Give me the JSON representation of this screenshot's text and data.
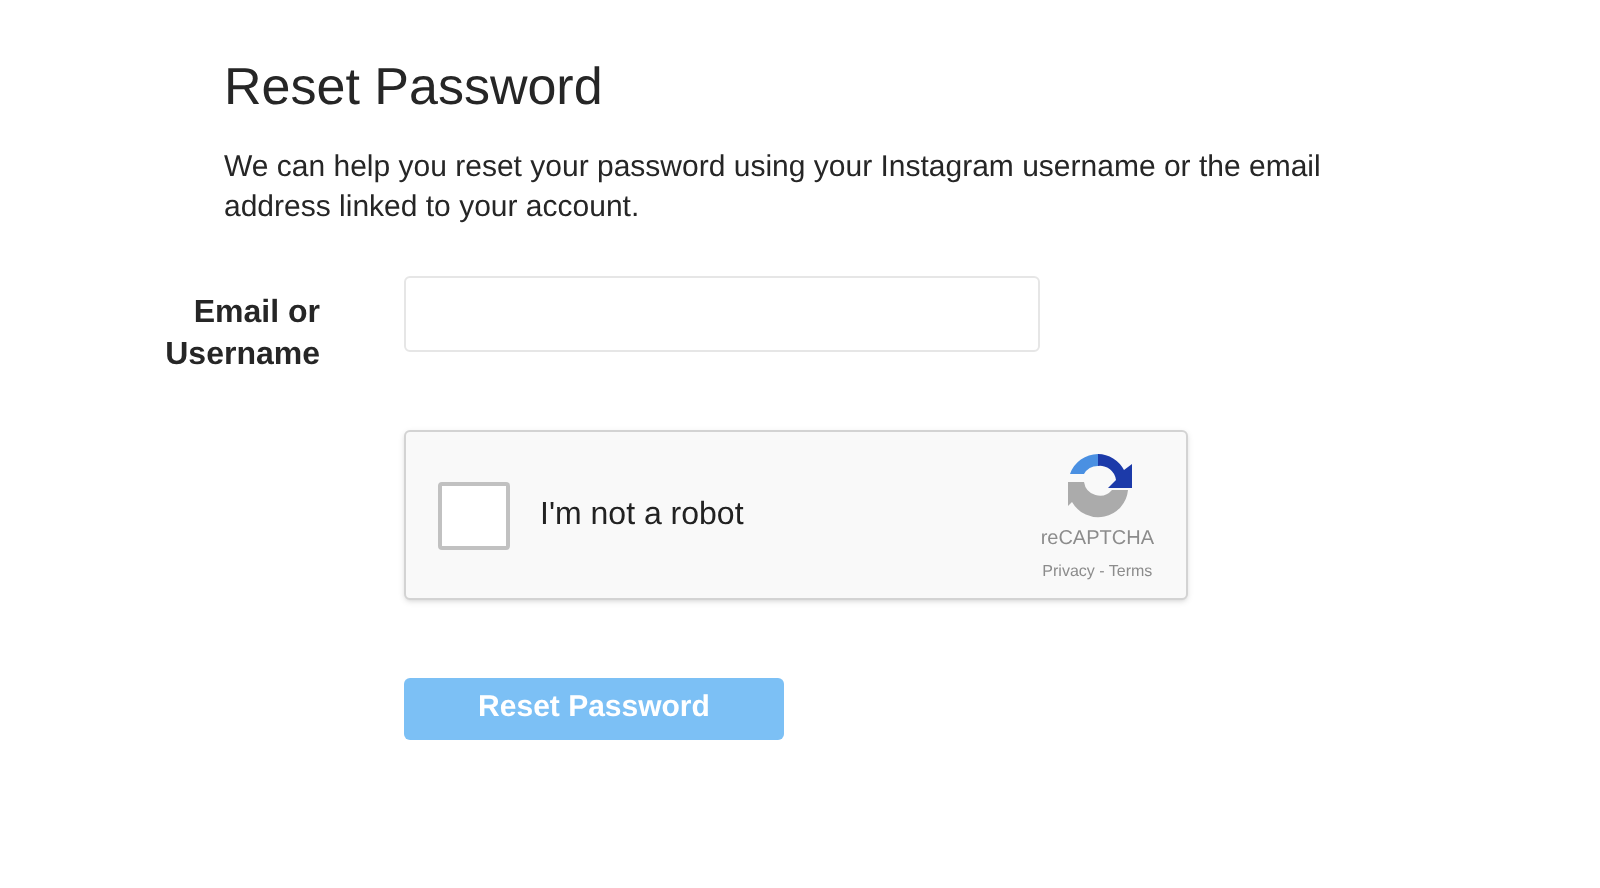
{
  "title": "Reset Password",
  "description": "We can help you reset your password using your Instagram username or the email address linked to your account.",
  "field": {
    "label": "Email or Username"
  },
  "captcha": {
    "checked": false,
    "label": "I'm not a robot",
    "brand": "reCAPTCHA",
    "links": "Privacy - Terms"
  },
  "submit": {
    "label": "Reset Password",
    "disabled": true
  }
}
